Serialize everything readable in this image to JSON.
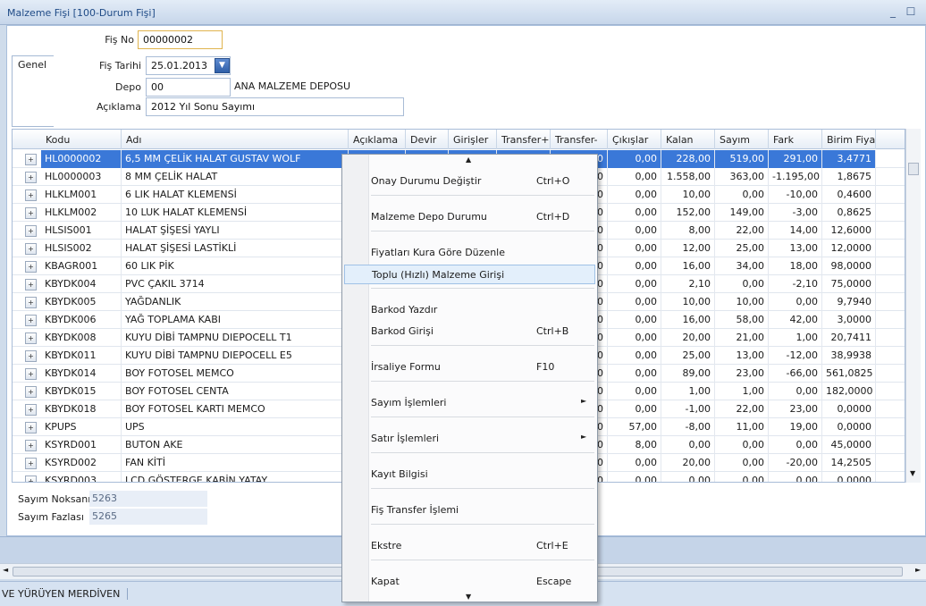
{
  "window": {
    "title": "Malzeme Fişi  [100-Durum Fişi]",
    "min": "_",
    "max": "☐"
  },
  "form": {
    "tab_label": "Genel",
    "fis_no_label": "Fiş No",
    "fis_no": "00000002",
    "fis_tarihi_label": "Fiş Tarihi",
    "fis_tarihi": "25.01.2013",
    "depo_label": "Depo",
    "depo_code": "00",
    "depo_name": "ANA MALZEME DEPOSU",
    "aciklama_label": "Açıklama",
    "aciklama": "2012 Yıl Sonu Sayımı"
  },
  "grid": {
    "columns": [
      "Kodu",
      "Adı",
      "Açıklama",
      "Devir",
      "Girişler",
      "Transfer+",
      "Transfer-",
      "Çıkışlar",
      "Kalan",
      "Sayım",
      "Fark",
      "Birim Fiya"
    ],
    "rows": [
      {
        "kodu": "HL0000002",
        "adi": "6,5 MM ÇELİK HALAT GUSTAV WOLF",
        "t": "0",
        "cikislar": "0,00",
        "kalan": "228,00",
        "sayim": "519,00",
        "fark": "291,00",
        "birim": "3,4771"
      },
      {
        "kodu": "HL0000003",
        "adi": "8 MM ÇELİK HALAT",
        "t": "0",
        "cikislar": "0,00",
        "kalan": "1.558,00",
        "sayim": "363,00",
        "fark": "-1.195,00",
        "birim": "1,8675"
      },
      {
        "kodu": "HLKLM001",
        "adi": "6 LIK HALAT KLEMENSİ",
        "t": "0",
        "cikislar": "0,00",
        "kalan": "10,00",
        "sayim": "0,00",
        "fark": "-10,00",
        "birim": "0,4600"
      },
      {
        "kodu": "HLKLM002",
        "adi": "10 LUK HALAT KLEMENSİ",
        "t": "0",
        "cikislar": "0,00",
        "kalan": "152,00",
        "sayim": "149,00",
        "fark": "-3,00",
        "birim": "0,8625"
      },
      {
        "kodu": "HLSIS001",
        "adi": "HALAT ŞİŞESİ YAYLI",
        "t": "0",
        "cikislar": "0,00",
        "kalan": "8,00",
        "sayim": "22,00",
        "fark": "14,00",
        "birim": "12,6000"
      },
      {
        "kodu": "HLSIS002",
        "adi": "HALAT ŞİŞESİ LASTİKLİ",
        "t": "0",
        "cikislar": "0,00",
        "kalan": "12,00",
        "sayim": "25,00",
        "fark": "13,00",
        "birim": "12,0000"
      },
      {
        "kodu": "KBAGR001",
        "adi": "60 LIK PİK",
        "t": "0",
        "cikislar": "0,00",
        "kalan": "16,00",
        "sayim": "34,00",
        "fark": "18,00",
        "birim": "98,0000"
      },
      {
        "kodu": "KBYDK004",
        "adi": "PVC ÇAKIL 3714",
        "t": "0",
        "cikislar": "0,00",
        "kalan": "2,10",
        "sayim": "0,00",
        "fark": "-2,10",
        "birim": "75,0000"
      },
      {
        "kodu": "KBYDK005",
        "adi": "YAĞDANLIK",
        "t": "0",
        "cikislar": "0,00",
        "kalan": "10,00",
        "sayim": "10,00",
        "fark": "0,00",
        "birim": "9,7940"
      },
      {
        "kodu": "KBYDK006",
        "adi": "YAĞ TOPLAMA KABI",
        "t": "0",
        "cikislar": "0,00",
        "kalan": "16,00",
        "sayim": "58,00",
        "fark": "42,00",
        "birim": "3,0000"
      },
      {
        "kodu": "KBYDK008",
        "adi": "KUYU DİBİ TAMPNU DIEPOCELL T1",
        "t": "0",
        "cikislar": "0,00",
        "kalan": "20,00",
        "sayim": "21,00",
        "fark": "1,00",
        "birim": "20,7411"
      },
      {
        "kodu": "KBYDK011",
        "adi": "KUYU DİBİ TAMPNU DIEPOCELL E5",
        "t": "0",
        "cikislar": "0,00",
        "kalan": "25,00",
        "sayim": "13,00",
        "fark": "-12,00",
        "birim": "38,9938"
      },
      {
        "kodu": "KBYDK014",
        "adi": "BOY FOTOSEL MEMCO",
        "t": "0",
        "cikislar": "0,00",
        "kalan": "89,00",
        "sayim": "23,00",
        "fark": "-66,00",
        "birim": "561,0825"
      },
      {
        "kodu": "KBYDK015",
        "adi": "BOY FOTOSEL CENTA",
        "t": "0",
        "cikislar": "0,00",
        "kalan": "1,00",
        "sayim": "1,00",
        "fark": "0,00",
        "birim": "182,0000"
      },
      {
        "kodu": "KBYDK018",
        "adi": "BOY FOTOSEL KARTI MEMCO",
        "t": "0",
        "cikislar": "0,00",
        "kalan": "-1,00",
        "sayim": "22,00",
        "fark": "23,00",
        "birim": "0,0000"
      },
      {
        "kodu": "KPUPS",
        "adi": "UPS",
        "t": "0",
        "cikislar": "57,00",
        "kalan": "-8,00",
        "sayim": "11,00",
        "fark": "19,00",
        "birim": "0,0000"
      },
      {
        "kodu": "KSYRD001",
        "adi": "BUTON AKE",
        "t": "0",
        "cikislar": "8,00",
        "kalan": "0,00",
        "sayim": "0,00",
        "fark": "0,00",
        "birim": "45,0000"
      },
      {
        "kodu": "KSYRD002",
        "adi": "FAN KİTİ",
        "t": "0",
        "cikislar": "0,00",
        "kalan": "20,00",
        "sayim": "0,00",
        "fark": "-20,00",
        "birim": "14,2505"
      },
      {
        "kodu": "KSYRD003",
        "adi": "LCD GÖSTERGE KABİN YATAY",
        "t": "0",
        "cikislar": "0,00",
        "kalan": "0,00",
        "sayim": "0,00",
        "fark": "0,00",
        "birim": "0,0000"
      }
    ]
  },
  "totals": {
    "noksani_label": "Sayım Noksanı",
    "noksani": "5263",
    "fazlasi_label": "Sayım Fazlası",
    "fazlasi": "5265"
  },
  "status": {
    "text": "VE YÜRÜYEN MERDİVEN"
  },
  "context_menu": {
    "items": [
      {
        "label": "Onay Durumu Değiştir",
        "shortcut": "Ctrl+O"
      },
      {
        "label": "Malzeme Depo Durumu",
        "shortcut": "Ctrl+D"
      },
      {
        "label": "Fiyatları Kura Göre Düzenle",
        "shortcut": ""
      },
      {
        "label": "Toplu (Hızlı) Malzeme Girişi",
        "shortcut": ""
      },
      {
        "label": "Barkod Yazdır",
        "shortcut": ""
      },
      {
        "label": "Barkod Girişi",
        "shortcut": "Ctrl+B"
      },
      {
        "label": "İrsaliye Formu",
        "shortcut": "F10"
      },
      {
        "label": "Sayım İşlemleri",
        "shortcut": ""
      },
      {
        "label": "Satır İşlemleri",
        "shortcut": ""
      },
      {
        "label": "Kayıt Bilgisi",
        "shortcut": ""
      },
      {
        "label": "Fiş Transfer İşlemi",
        "shortcut": ""
      },
      {
        "label": "Ekstre",
        "shortcut": "Ctrl+E"
      },
      {
        "label": "Kapat",
        "shortcut": "Escape"
      }
    ]
  },
  "icons": [
    "expand-row-icon",
    "calendar-dropdown-icon",
    "submenu-arrow-icon",
    "scroll-up-icon",
    "scroll-down-icon"
  ]
}
